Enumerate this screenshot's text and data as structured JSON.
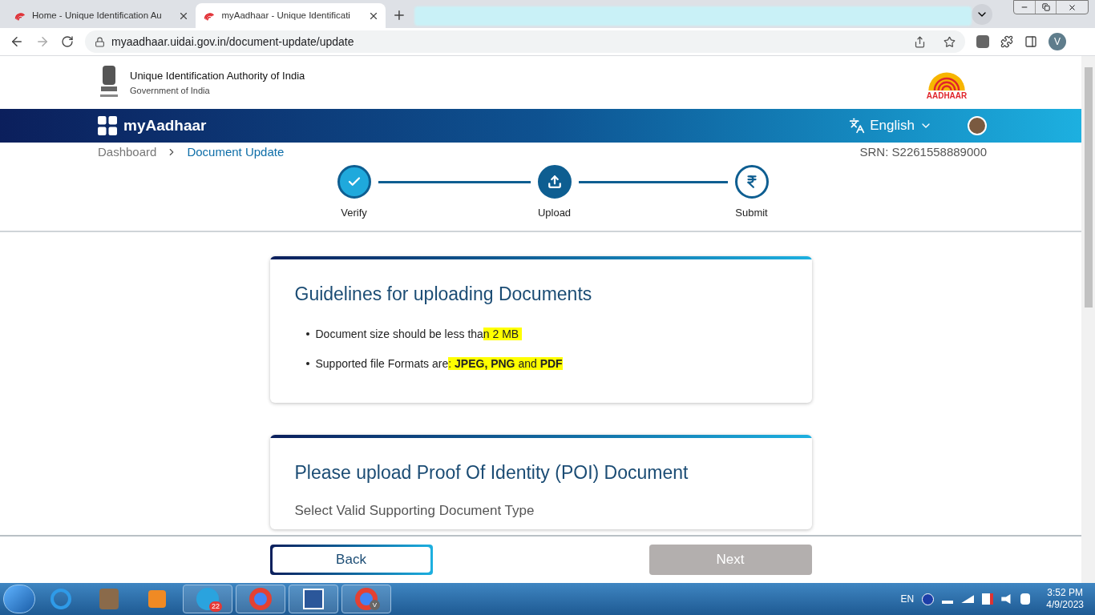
{
  "browser": {
    "tabs": [
      {
        "title": "Home - Unique Identification Au",
        "selected": false
      },
      {
        "title": "myAadhaar - Unique Identificati",
        "selected": true
      }
    ],
    "url": "myaadhaar.uidai.gov.in/document-update/update",
    "profile": "V"
  },
  "header": {
    "org": "Unique Identification Authority of India",
    "gov": "Government of India",
    "logo_text": "AADHAAR"
  },
  "navbar": {
    "brand": "myAadhaar",
    "language": "English"
  },
  "breadcrumb": [
    {
      "label": "Dashboard",
      "selected": false
    },
    {
      "label": "Document Update",
      "selected": true
    }
  ],
  "srn": "SRN: S2261558889000",
  "steps": [
    {
      "label": "Verify",
      "completed": true,
      "selected": false
    },
    {
      "label": "Upload",
      "completed": false,
      "selected": true
    },
    {
      "label": "Submit",
      "completed": false,
      "selected": false
    }
  ],
  "guidelines": {
    "title": "Guidelines for uploading Documents",
    "items": [
      [
        {
          "text": "Document size should be less tha",
          "bold": false,
          "highlighted": false
        },
        {
          "text": "n 2 MB ",
          "bold": false,
          "highlighted": true
        }
      ],
      [
        {
          "text": "Supported file Formats are",
          "bold": false,
          "highlighted": false
        },
        {
          "text": ": ",
          "bold": false,
          "highlighted": true
        },
        {
          "text": "JPEG, PNG",
          "bold": true,
          "highlighted": true
        },
        {
          "text": " and ",
          "bold": false,
          "highlighted": true
        },
        {
          "text": "PDF",
          "bold": true,
          "highlighted": true
        }
      ]
    ]
  },
  "poi": {
    "title": "Please upload Proof Of Identity (POI) Document",
    "field_label": "Select Valid Supporting Document Type"
  },
  "footer": {
    "back": "Back",
    "next": "Next",
    "next_disabled": true
  },
  "taskbar": {
    "telegram_badge": "22",
    "chrome_badge": "V",
    "lang": "EN",
    "time": "3:52 PM",
    "date": "4/9/2023"
  }
}
